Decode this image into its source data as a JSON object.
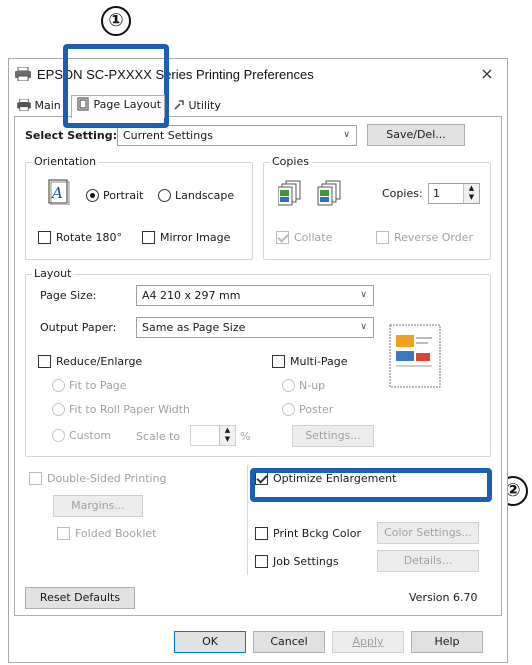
{
  "callouts": {
    "one": "①",
    "two": "②"
  },
  "window": {
    "title": "EPSON SC-PXXXX Series Printing Preferences",
    "close_glyph": "×",
    "icon": "printer-icon"
  },
  "tabs": [
    {
      "label": "Main",
      "icon": "printer-icon"
    },
    {
      "label": "Page Layout",
      "icon": "page-layout-icon"
    },
    {
      "label": "Utility",
      "icon": "utility-icon"
    }
  ],
  "select_setting": {
    "label": "Select Setting:",
    "value": "Current Settings",
    "save_label": "Save/Del..."
  },
  "orientation": {
    "title": "Orientation",
    "portrait": "Portrait",
    "landscape": "Landscape",
    "selected": "Portrait",
    "rotate": "Rotate 180°",
    "mirror": "Mirror Image"
  },
  "copies": {
    "title": "Copies",
    "label": "Copies:",
    "value": "1",
    "collate": "Collate",
    "reverse": "Reverse Order"
  },
  "layout": {
    "title": "Layout",
    "page_size_label": "Page Size:",
    "page_size_value": "A4 210 x 297 mm",
    "output_label": "Output Paper:",
    "output_value": "Same as Page Size",
    "reduce": "Reduce/Enlarge",
    "fit_page": "Fit to Page",
    "fit_roll": "Fit to Roll Paper Width",
    "custom": "Custom",
    "scale_to": "Scale to",
    "percent": "%",
    "multipage": "Multi-Page",
    "nup": "N-up",
    "poster": "Poster",
    "settings": "Settings..."
  },
  "double_sided": {
    "label": "Double-Sided Printing",
    "margins": "Margins...",
    "folded": "Folded Booklet"
  },
  "optimize": {
    "label": "Optimize Enlargement",
    "checked": true
  },
  "print_bckg": {
    "label": "Print Bckg Color",
    "button": "Color Settings..."
  },
  "job": {
    "label": "Job Settings",
    "button": "Details..."
  },
  "footer": {
    "reset": "Reset Defaults",
    "version": "Version 6.70"
  },
  "buttons": {
    "ok": "OK",
    "cancel": "Cancel",
    "apply": "Apply",
    "help": "Help"
  },
  "colors": {
    "callout": "#1a5fb4",
    "focus": "#0078d7"
  }
}
